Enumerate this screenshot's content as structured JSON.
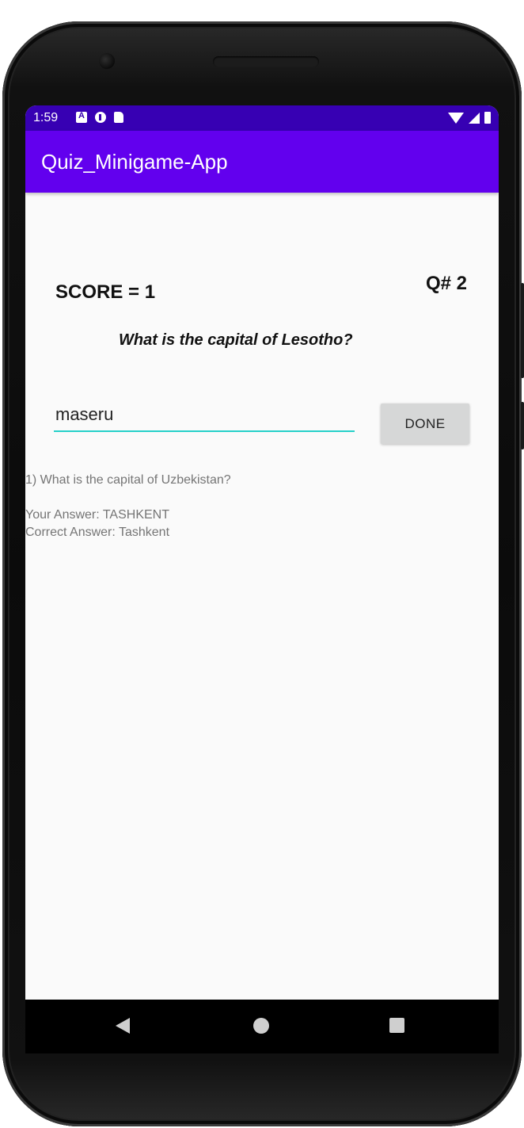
{
  "status_bar": {
    "time": "1:59",
    "left_icons": [
      "a-notification-icon",
      "data-saver-icon",
      "sd-card-icon"
    ],
    "right_icons": [
      "wifi-icon",
      "signal-icon",
      "battery-icon"
    ]
  },
  "app_bar": {
    "title": "Quiz_Minigame-App"
  },
  "quiz": {
    "score_label": "SCORE = 1",
    "question_number": "Q# 2",
    "question": "What is the capital of Lesotho?",
    "answer_value": "maseru",
    "done_label": "DONE"
  },
  "history": {
    "question": "1) What is the capital of Uzbekistan?",
    "your_answer": "Your Answer: TASHKENT",
    "correct_answer": "Correct Answer: Tashkent"
  },
  "nav_bar": {
    "icons": [
      "back-icon",
      "home-icon",
      "recents-icon"
    ]
  },
  "colors": {
    "status_bar": "#3700b3",
    "app_bar": "#6200ee",
    "input_underline": "#26d0c9",
    "button_bg": "#d6d7d7",
    "background": "#fafafa"
  }
}
